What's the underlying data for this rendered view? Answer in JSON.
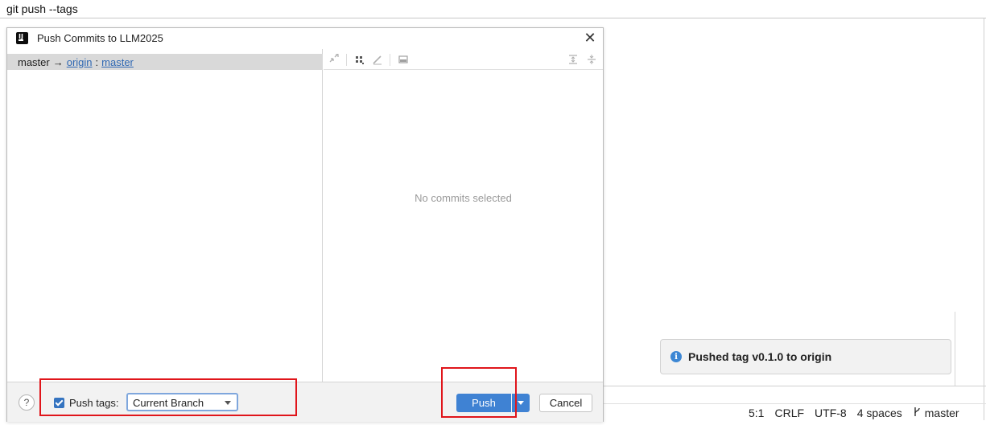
{
  "command_text": "git push --tags",
  "dialog": {
    "title": "Push Commits to LLM2025",
    "app_icon": "intellij-idea-icon",
    "close_icon": "close-icon",
    "branch_row": {
      "local_branch": "master",
      "arrow": "→",
      "remote": "origin",
      "separator": ":",
      "remote_branch": "master"
    },
    "toolbar_icons": [
      "expand-icon",
      "group-by-icon",
      "edit-icon",
      "preview-icon",
      "expand-all-icon",
      "collapse-all-icon"
    ],
    "empty_message": "No commits selected",
    "footer": {
      "help_label": "?",
      "push_tags_label": "Push tags:",
      "push_tags_checked": true,
      "tag_scope_value": "Current Branch",
      "push_label": "Push",
      "cancel_label": "Cancel"
    }
  },
  "notification": {
    "icon": "info-icon",
    "text": "Pushed tag v0.1.0 to origin"
  },
  "status_bar": {
    "position": "5:1",
    "line_ending": "CRLF",
    "encoding": "UTF-8",
    "indent": "4 spaces",
    "branch": "master"
  },
  "colors": {
    "accent": "#3f82d3",
    "highlight": "#e0151b",
    "link": "#2f68b3"
  }
}
